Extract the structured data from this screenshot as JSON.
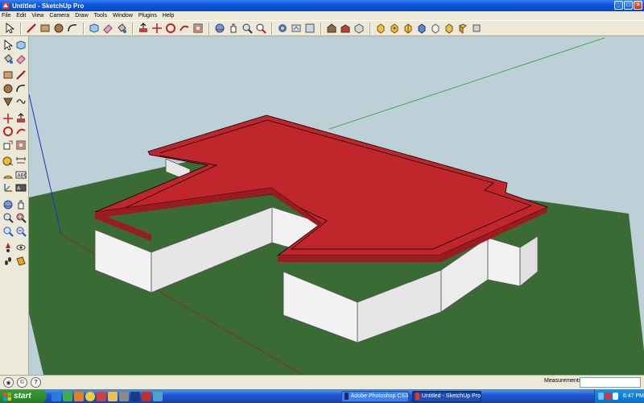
{
  "window": {
    "title": "Untitled - SketchUp Pro",
    "buttons": [
      "minimize",
      "maximize",
      "close"
    ]
  },
  "menu": [
    "File",
    "Edit",
    "View",
    "Camera",
    "Draw",
    "Tools",
    "Window",
    "Plugins",
    "Help"
  ],
  "top_toolbar": [
    "select-icon",
    "line-icon",
    "rectangle-icon",
    "circle-icon",
    "arc-icon",
    "make-component-icon",
    "eraser-icon",
    "paint-bucket-icon",
    "push-pull-icon",
    "move-icon",
    "rotate-icon",
    "follow-me-icon",
    "offset-icon",
    "orbit-icon",
    "pan-icon",
    "zoom-icon",
    "zoom-extents-icon",
    "get-models-icon",
    "share-model-icon",
    "get-photo-texture-icon",
    "components-icon",
    "warehouse-icon",
    "style-xray-icon",
    "style-wireframe-icon",
    "style-hidden-line-icon",
    "style-shaded-icon",
    "style-textured-icon",
    "style-monochrome-icon",
    "view-iso-icon"
  ],
  "left_toolbar": [
    [
      "select-icon",
      "make-component-icon"
    ],
    [
      "paint-bucket-icon",
      "eraser-icon"
    ],
    [
      "rectangle-icon",
      "line-icon"
    ],
    [
      "circle-icon",
      "arc-icon"
    ],
    [
      "polygon-icon",
      "freehand-icon"
    ],
    [
      "move-icon",
      "push-pull-icon"
    ],
    [
      "rotate-icon",
      "follow-me-icon"
    ],
    [
      "scale-icon",
      "offset-icon"
    ],
    [
      "tape-measure-icon",
      "dimension-icon"
    ],
    [
      "protractor-icon",
      "text-icon"
    ],
    [
      "axes-icon",
      "3d-text-icon"
    ],
    [
      "orbit-icon",
      "pan-icon"
    ],
    [
      "zoom-icon",
      "zoom-window-icon"
    ],
    [
      "zoom-extents-icon",
      "previous-view-icon"
    ],
    [
      "position-camera-icon",
      "look-around-icon"
    ],
    [
      "walk-icon",
      "section-plane-icon"
    ]
  ],
  "status": {
    "measurements_label": "Measurements",
    "measurements_value": ""
  },
  "taskbar": {
    "start_label": "start",
    "tasks": [
      "Adobe Photoshop CS3",
      "Untitled - SketchUp Pro"
    ],
    "clock": "6:47 PM"
  },
  "colors": {
    "roof": "#c0262b",
    "ground": "#3a6b34",
    "walls": "#f0f0f0",
    "sky": "#bdcfd7"
  }
}
